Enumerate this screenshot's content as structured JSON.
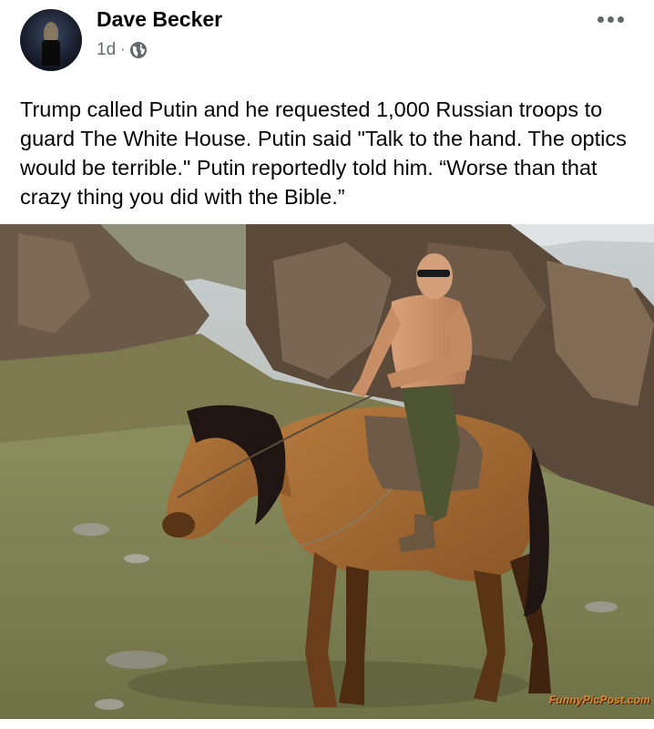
{
  "post": {
    "author": "Dave Becker",
    "time": "1d",
    "separator": "·",
    "privacy_icon": "globe-icon",
    "more_icon": "more-options-icon",
    "text": "Trump called Putin and he requested 1,000 Russian troops to guard The White House.  Putin said \"Talk to the hand. The optics would be terrible.\" Putin reportedly told him. “Worse than that crazy thing you did with the Bible.”"
  },
  "photo": {
    "watermark": "FunnyPicPost.com"
  },
  "colors": {
    "name_text": "#050505",
    "meta_text": "#65676b",
    "watermark": "#e0852f"
  }
}
